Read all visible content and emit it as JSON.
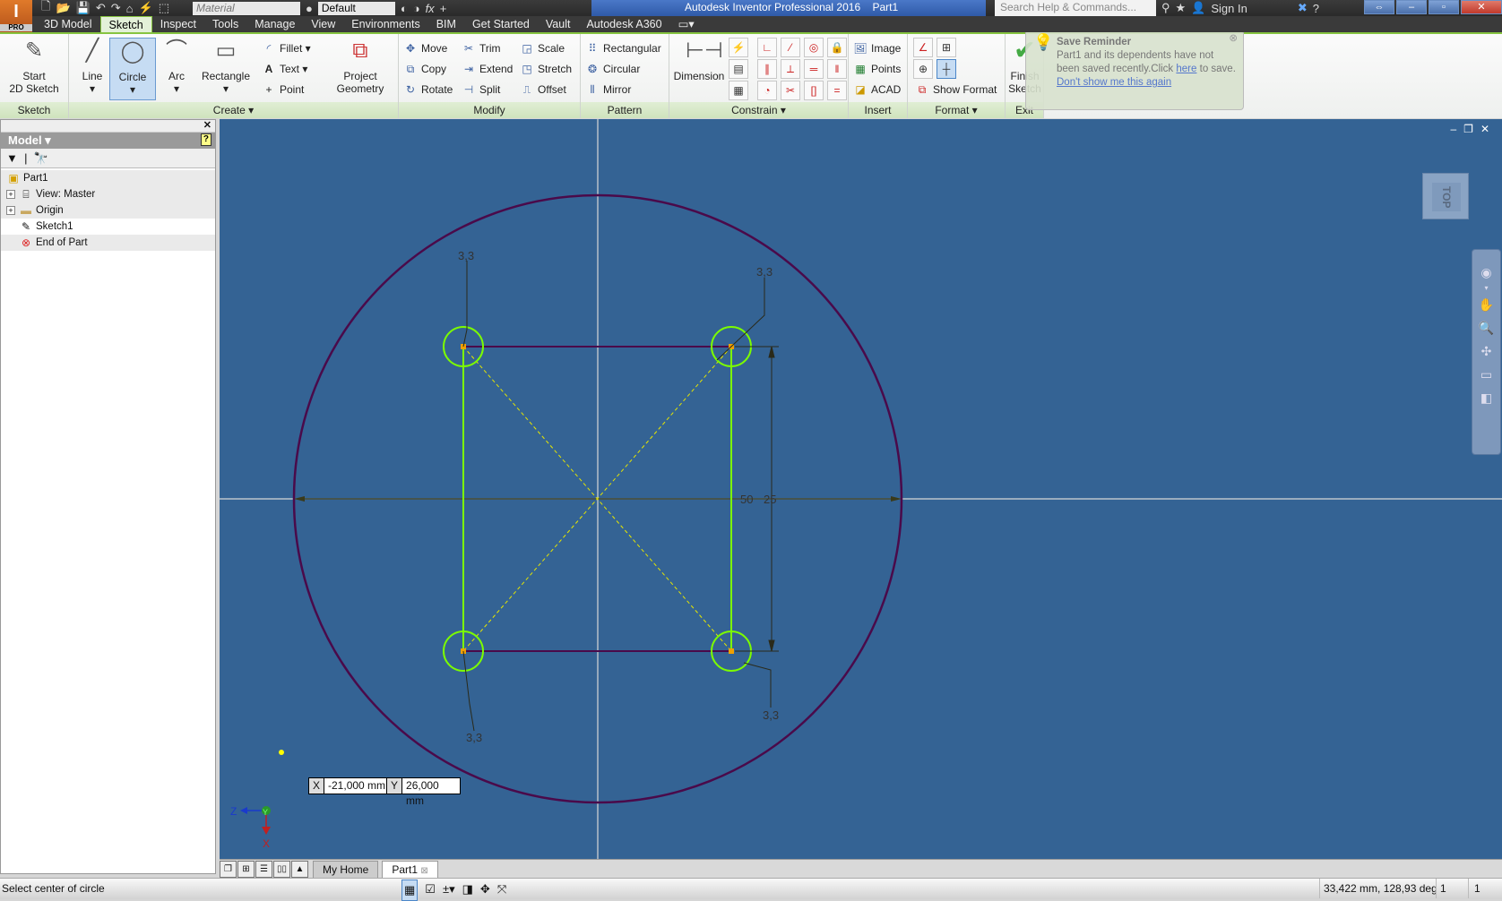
{
  "app": {
    "badge": "PRO",
    "title": "Autodesk Inventor Professional 2016",
    "document": "Part1"
  },
  "qat": {
    "material": "Material",
    "appearance": "Default",
    "search_placeholder": "Search Help & Commands...",
    "sign_in": "Sign In"
  },
  "menu": [
    "3D Model",
    "Sketch",
    "Inspect",
    "Tools",
    "Manage",
    "View",
    "Environments",
    "BIM",
    "Get Started",
    "Vault",
    "Autodesk A360"
  ],
  "active_menu": "Sketch",
  "ribbon": {
    "sketch": {
      "label": "Sketch",
      "start": "Start",
      "start2": "2D Sketch"
    },
    "create": {
      "label": "Create",
      "line": "Line",
      "circle": "Circle",
      "arc": "Arc",
      "rectangle": "Rectangle",
      "fillet": "Fillet",
      "text": "Text",
      "point": "Point",
      "project": "Project",
      "project2": "Geometry"
    },
    "modify": {
      "label": "Modify",
      "move": "Move",
      "copy": "Copy",
      "rotate": "Rotate",
      "trim": "Trim",
      "extend": "Extend",
      "split": "Split",
      "scale": "Scale",
      "stretch": "Stretch",
      "offset": "Offset"
    },
    "pattern": {
      "label": "Pattern",
      "rectangular": "Rectangular",
      "circular": "Circular",
      "mirror": "Mirror"
    },
    "constrain": {
      "label": "Constrain",
      "dimension": "Dimension"
    },
    "insert": {
      "label": "Insert",
      "image": "Image",
      "points": "Points",
      "acad": "ACAD"
    },
    "format": {
      "label": "Format",
      "show_format": "Show Format"
    },
    "exit": {
      "label": "Exit",
      "finish": "Finish",
      "finish2": "Sketch"
    }
  },
  "reminder": {
    "title": "Save Reminder",
    "body": "Part1 and its dependents have not been saved recently.Click",
    "link": "here",
    "tail": "to save.",
    "dismiss": "Don't show me this again"
  },
  "browser": {
    "title": "Model",
    "items": [
      {
        "label": "Part1",
        "icon": "part-icon"
      },
      {
        "label": "View: Master",
        "icon": "view-icon"
      },
      {
        "label": "Origin",
        "icon": "folder-icon"
      },
      {
        "label": "Sketch1",
        "icon": "sketch-icon"
      },
      {
        "label": "End of Part",
        "icon": "end-of-part-icon"
      }
    ]
  },
  "canvas": {
    "viewcube": "TOP",
    "dims": {
      "d50": "50",
      "d25": "25",
      "r1": "3,3",
      "r2": "3,3",
      "r3": "3,3",
      "r4": "3,3"
    },
    "input": {
      "x_label": "X",
      "x_value": "-21,000 mm",
      "y_label": "Y",
      "y_value": "26,000 mm"
    },
    "triad": {
      "z": "Z",
      "y": "Y",
      "x": "X"
    },
    "colors": {
      "background": "#346394",
      "outer_circle": "#4a0a4a",
      "small_circles": "#7cfc00",
      "construction": "#e6e600"
    }
  },
  "doctabs": {
    "home": "My Home",
    "part": "Part1"
  },
  "status": {
    "prompt": "Select center of circle",
    "readout": "33,422 mm, 128,93 deg",
    "count1": "1",
    "count2": "1"
  }
}
